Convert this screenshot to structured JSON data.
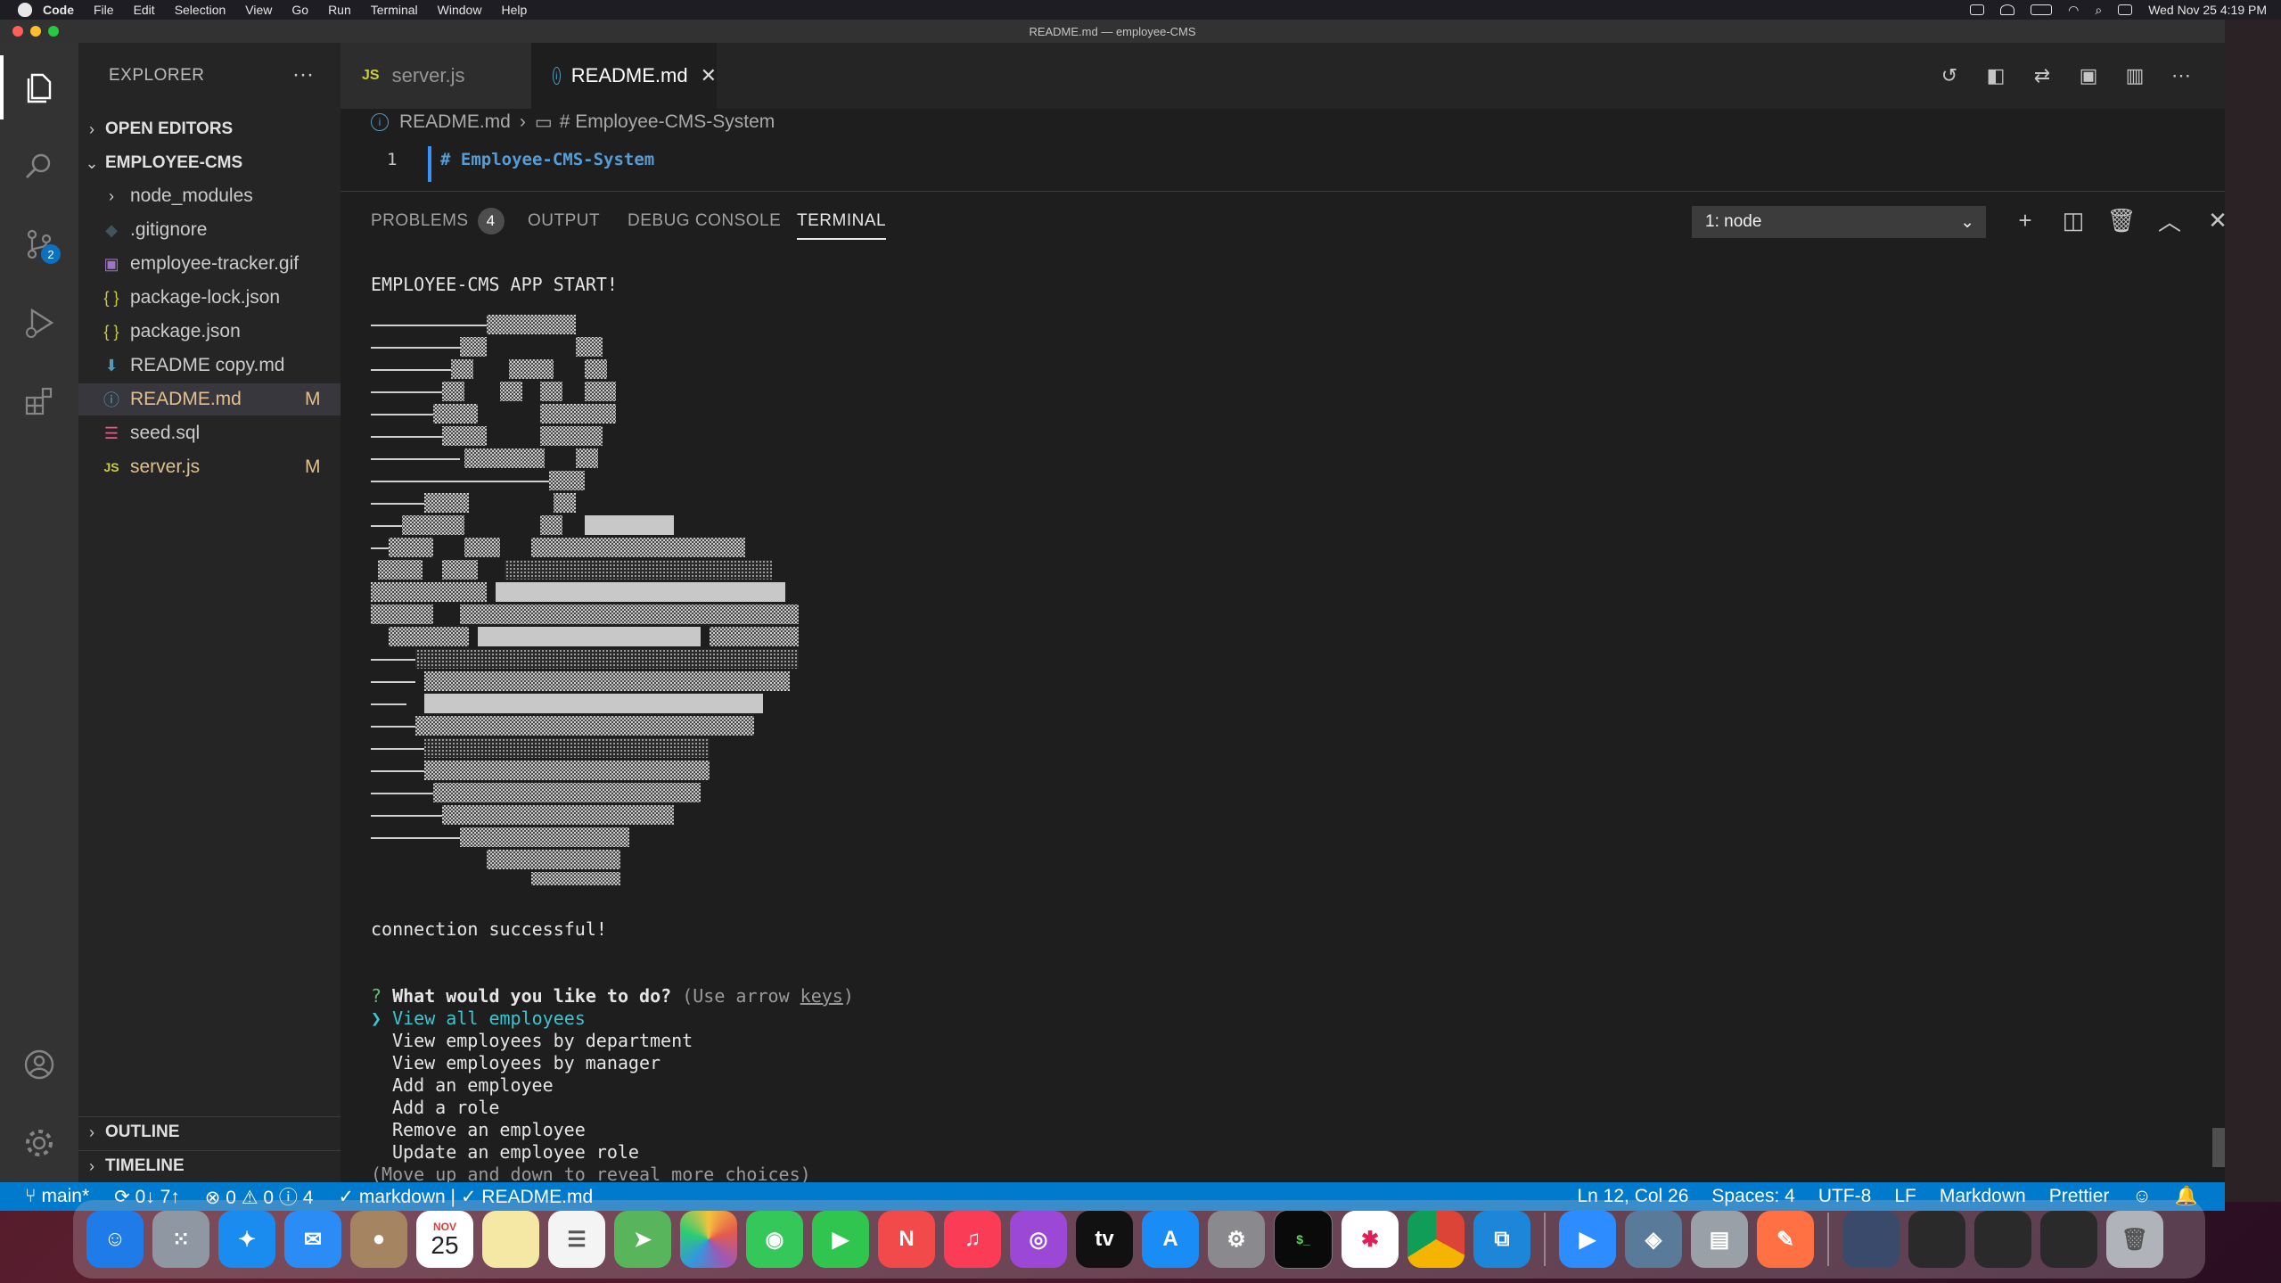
{
  "menubar": {
    "app": "Code",
    "items": [
      "File",
      "Edit",
      "Selection",
      "View",
      "Go",
      "Run",
      "Terminal",
      "Window",
      "Help"
    ],
    "clock": "Wed Nov 25  4:19 PM"
  },
  "window": {
    "title": "README.md — employee-CMS"
  },
  "activity": {
    "scm_badge": "2"
  },
  "sidebar": {
    "title": "EXPLORER",
    "more": "···",
    "open_editors": "OPEN EDITORS",
    "project": "EMPLOYEE-CMS",
    "files": [
      {
        "name": "node_modules",
        "icon": "folder-chevron",
        "mark": ""
      },
      {
        "name": ".gitignore",
        "icon": "git-icon",
        "mark": ""
      },
      {
        "name": "employee-tracker.gif",
        "icon": "image-icon",
        "mark": ""
      },
      {
        "name": "package-lock.json",
        "icon": "json-icon",
        "mark": ""
      },
      {
        "name": "package.json",
        "icon": "json-icon",
        "mark": ""
      },
      {
        "name": "README copy.md",
        "icon": "markdown-icon",
        "mark": ""
      },
      {
        "name": "README.md",
        "icon": "info-icon",
        "mark": "M"
      },
      {
        "name": "seed.sql",
        "icon": "database-icon",
        "mark": ""
      },
      {
        "name": "server.js",
        "icon": "js-icon",
        "mark": "M"
      }
    ],
    "outline": "OUTLINE",
    "timeline": "TIMELINE"
  },
  "tabs": [
    {
      "label": "server.js",
      "icon": "JS"
    },
    {
      "label": "README.md",
      "icon": "i"
    }
  ],
  "breadcrumb": {
    "file": "README.md",
    "section": "# Employee-CMS-System"
  },
  "editor": {
    "line_number": "1",
    "code": "# Employee-CMS-System"
  },
  "panel": {
    "tabs": {
      "problems": "PROBLEMS",
      "problems_count": "4",
      "output": "OUTPUT",
      "debug": "DEBUG CONSOLE",
      "terminal": "TERMINAL"
    },
    "terminal_select": "1: node"
  },
  "terminal": {
    "banner": "EMPLOYEE-CMS APP START!",
    "connection": "connection successful!",
    "prompt_mark": "?",
    "question": "What would you like to do?",
    "hint_prefix": "(Use arrow ",
    "hint_keys": "keys",
    "hint_suffix": ")",
    "pointer": "❯",
    "options": [
      "View all employees",
      "View employees by department",
      "View employees by manager",
      "Add an employee",
      "Add a role",
      "Remove an employee",
      "Update an employee role"
    ],
    "more_hint": "(Move up and down to reveal more choices)"
  },
  "statusbar": {
    "branch": "main*",
    "sync": "0↓ 7↑",
    "problems": "⊗ 0 ⚠ 0 ⓘ 4",
    "lang_check": "✓ markdown | ✓ README.md",
    "position": "Ln 12, Col 26",
    "spaces": "Spaces: 4",
    "encoding": "UTF-8",
    "eol": "LF",
    "language": "Markdown",
    "formatter": "Prettier"
  },
  "dock": {
    "calendar_month": "NOV",
    "calendar_day": "25",
    "tv_label": "tv"
  }
}
